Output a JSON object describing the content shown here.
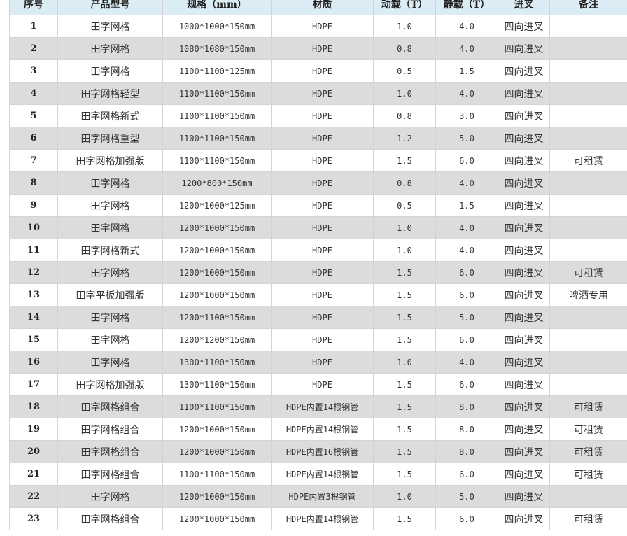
{
  "headers": [
    "序号",
    "产品型号",
    "规格（mm）",
    "材质",
    "动载（T）",
    "静载（T）",
    "进叉",
    "备注"
  ],
  "rows": [
    [
      "1",
      "田字网格",
      "1000*1000*150mm",
      "HDPE",
      "1.0",
      "4.0",
      "四向进叉",
      ""
    ],
    [
      "2",
      "田字网格",
      "1080*1080*150mm",
      "HDPE",
      "0.8",
      "4.0",
      "四向进叉",
      ""
    ],
    [
      "3",
      "田字网格",
      "1100*1100*125mm",
      "HDPE",
      "0.5",
      "1.5",
      "四向进叉",
      ""
    ],
    [
      "4",
      "田字网格轻型",
      "1100*1100*150mm",
      "HDPE",
      "1.0",
      "4.0",
      "四向进叉",
      ""
    ],
    [
      "5",
      "田字网格新式",
      "1100*1100*150mm",
      "HDPE",
      "0.8",
      "3.0",
      "四向进叉",
      ""
    ],
    [
      "6",
      "田字网格重型",
      "1100*1100*150mm",
      "HDPE",
      "1.2",
      "5.0",
      "四向进叉",
      ""
    ],
    [
      "7",
      "田字网格加强版",
      "1100*1100*150mm",
      "HDPE",
      "1.5",
      "6.0",
      "四向进叉",
      "可租赁"
    ],
    [
      "8",
      "田字网格",
      "1200*800*150mm",
      "HDPE",
      "0.8",
      "4.0",
      "四向进叉",
      ""
    ],
    [
      "9",
      "田字网格",
      "1200*1000*125mm",
      "HDPE",
      "0.5",
      "1.5",
      "四向进叉",
      ""
    ],
    [
      "10",
      "田字网格",
      "1200*1000*150mm",
      "HDPE",
      "1.0",
      "4.0",
      "四向进叉",
      ""
    ],
    [
      "11",
      "田字网格新式",
      "1200*1000*150mm",
      "HDPE",
      "1.0",
      "4.0",
      "四向进叉",
      ""
    ],
    [
      "12",
      "田字网格",
      "1200*1000*150mm",
      "HDPE",
      "1.5",
      "6.0",
      "四向进叉",
      "可租赁"
    ],
    [
      "13",
      "田字平板加强版",
      "1200*1000*150mm",
      "HDPE",
      "1.5",
      "6.0",
      "四向进叉",
      "啤酒专用"
    ],
    [
      "14",
      "田字网格",
      "1200*1100*150mm",
      "HDPE",
      "1.5",
      "5.0",
      "四向进叉",
      ""
    ],
    [
      "15",
      "田字网格",
      "1200*1200*150mm",
      "HDPE",
      "1.5",
      "6.0",
      "四向进叉",
      ""
    ],
    [
      "16",
      "田字网格",
      "1300*1100*150mm",
      "HDPE",
      "1.0",
      "4.0",
      "四向进叉",
      ""
    ],
    [
      "17",
      "田字网格加强版",
      "1300*1100*150mm",
      "HDPE",
      "1.5",
      "6.0",
      "四向进叉",
      ""
    ],
    [
      "18",
      "田字网格组合",
      "1100*1100*150mm",
      "HDPE内置14根钢管",
      "1.5",
      "8.0",
      "四向进叉",
      "可租赁"
    ],
    [
      "19",
      "田字网格组合",
      "1200*1000*150mm",
      "HDPE内置14根钢管",
      "1.5",
      "8.0",
      "四向进叉",
      "可租赁"
    ],
    [
      "20",
      "田字网格组合",
      "1200*1000*150mm",
      "HDPE内置16根钢管",
      "1.5",
      "8.0",
      "四向进叉",
      "可租赁"
    ],
    [
      "21",
      "田字网格组合",
      "1100*1100*150mm",
      "HDPE内置14根钢管",
      "1.5",
      "6.0",
      "四向进叉",
      "可租赁"
    ],
    [
      "22",
      "田字网格",
      "1200*1000*150mm",
      "HDPE内置3根钢管",
      "1.0",
      "5.0",
      "四向进叉",
      ""
    ],
    [
      "23",
      "田字网格组合",
      "1200*1000*150mm",
      "HDPE内置14根钢管",
      "1.5",
      "6.0",
      "四向进叉",
      "可租赁"
    ]
  ]
}
